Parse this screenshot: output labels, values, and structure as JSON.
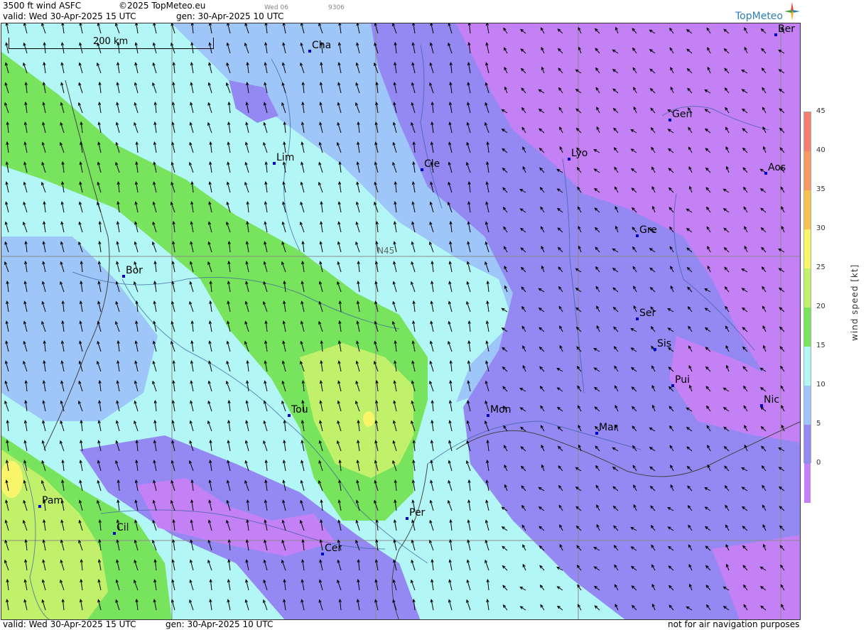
{
  "header": {
    "product": "3500 ft wind ASFC",
    "copyright": "©2025 TopMeteo.eu",
    "small1": "Wed 06",
    "small2": "9306",
    "valid": "valid:  Wed  30-Apr-2025  15 UTC",
    "gen": "gen: 30-Apr-2025 10 UTC"
  },
  "footer": {
    "valid": "valid:  Wed  30-Apr-2025  15 UTC",
    "gen": "gen: 30-Apr-2025 10 UTC",
    "disclaimer": "not for air navigation purposes"
  },
  "logo": {
    "text": "TopMeteo"
  },
  "scale": {
    "label": "200 km"
  },
  "grid": {
    "lat_label": "N45"
  },
  "cities": [
    {
      "name": "Cha"
    },
    {
      "name": "Ber"
    },
    {
      "name": "Gen"
    },
    {
      "name": "Lyo"
    },
    {
      "name": "Lim"
    },
    {
      "name": "Cle"
    },
    {
      "name": "Aos"
    },
    {
      "name": "Gre"
    },
    {
      "name": "Bor"
    },
    {
      "name": "Ser"
    },
    {
      "name": "Sis"
    },
    {
      "name": "Pui"
    },
    {
      "name": "Tou"
    },
    {
      "name": "Mon"
    },
    {
      "name": "Nic"
    },
    {
      "name": "Mar"
    },
    {
      "name": "Pam"
    },
    {
      "name": "Cil"
    },
    {
      "name": "Per"
    },
    {
      "name": "Cer"
    }
  ],
  "colorbar": {
    "unit": "wind speed [kt]",
    "ticks": [
      "45",
      "40",
      "35",
      "30",
      "25",
      "20",
      "15",
      "10",
      "5",
      "0"
    ],
    "colors": [
      "#f47d6f",
      "#f59a60",
      "#f7c24f",
      "#f8f56a",
      "#c1f06a",
      "#78e35c",
      "#b2f7f5",
      "#9fc6f8",
      "#9489f2",
      "#c480f5"
    ]
  }
}
